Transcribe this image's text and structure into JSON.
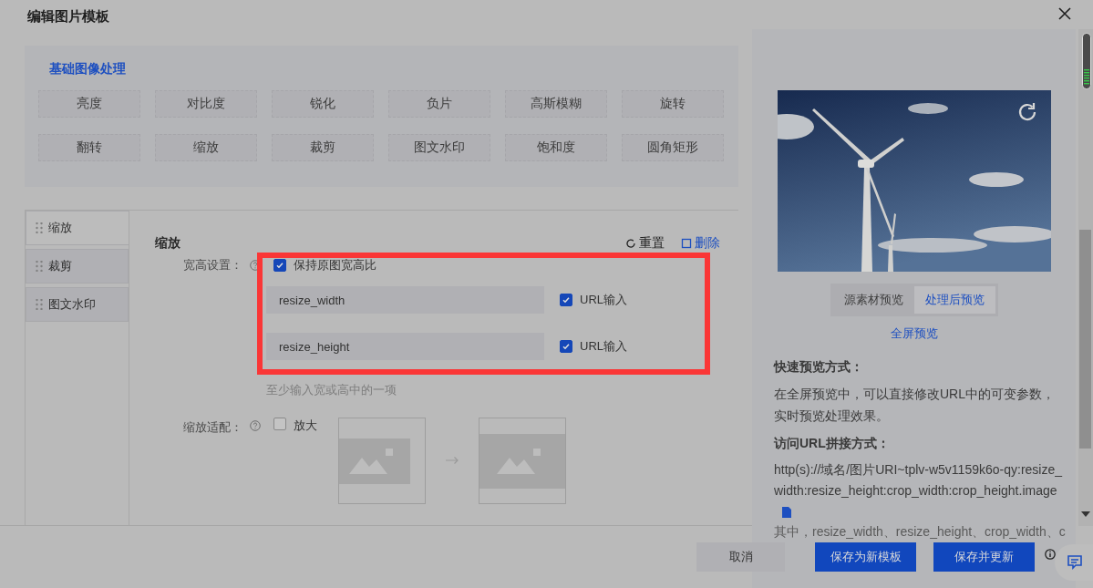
{
  "dialog": {
    "title": "编辑图片模板"
  },
  "basic_panel": {
    "heading": "基础图像处理",
    "operations": [
      "亮度",
      "对比度",
      "锐化",
      "负片",
      "高斯模糊",
      "旋转",
      "翻转",
      "缩放",
      "裁剪",
      "图文水印",
      "饱和度",
      "圆角矩形"
    ]
  },
  "steps": [
    {
      "label": "缩放",
      "selected": true
    },
    {
      "label": "裁剪",
      "selected": false
    },
    {
      "label": "图文水印",
      "selected": false
    }
  ],
  "section": {
    "title": "缩放",
    "actions": [
      {
        "label": "重置",
        "kind": "reset"
      },
      {
        "label": "删除",
        "kind": "delete"
      }
    ],
    "size_label": "宽高设置：",
    "keep_ratio": {
      "label": "保持原图宽高比",
      "checked": true
    },
    "fields": [
      {
        "value": "resize_width",
        "url_label": "URL输入",
        "url_input": true
      },
      {
        "value": "resize_height",
        "url_label": "URL输入",
        "url_input": true
      }
    ],
    "hint": "至少输入宽或高中的一项",
    "fit_label": "缩放适配：",
    "enlarge": {
      "label": "放大",
      "checked": false
    }
  },
  "preview": {
    "tabs": [
      {
        "label": "源素材预览",
        "selected": false
      },
      {
        "label": "处理后预览",
        "selected": true
      }
    ],
    "fullscreen_link": "全屏预览",
    "quick_heading": "快速预览方式：",
    "quick_text": "在全屏预览中，可以直接修改URL中的可变参数，实时预览处理效果。",
    "url_heading": "访问URL拼接方式：",
    "url_text": "http(s)://域名/图片URI~tplv-w5v1159k6o-qy:resize_width:resize_height:crop_width:crop_height.image",
    "note": "其中，resize_width、resize_height、crop_width、c"
  },
  "footer": {
    "buttons": [
      {
        "label": "取消",
        "kind": "secondary"
      },
      {
        "label": "保存为新模板",
        "kind": "primary"
      },
      {
        "label": "保存并更新",
        "kind": "primary"
      }
    ]
  }
}
